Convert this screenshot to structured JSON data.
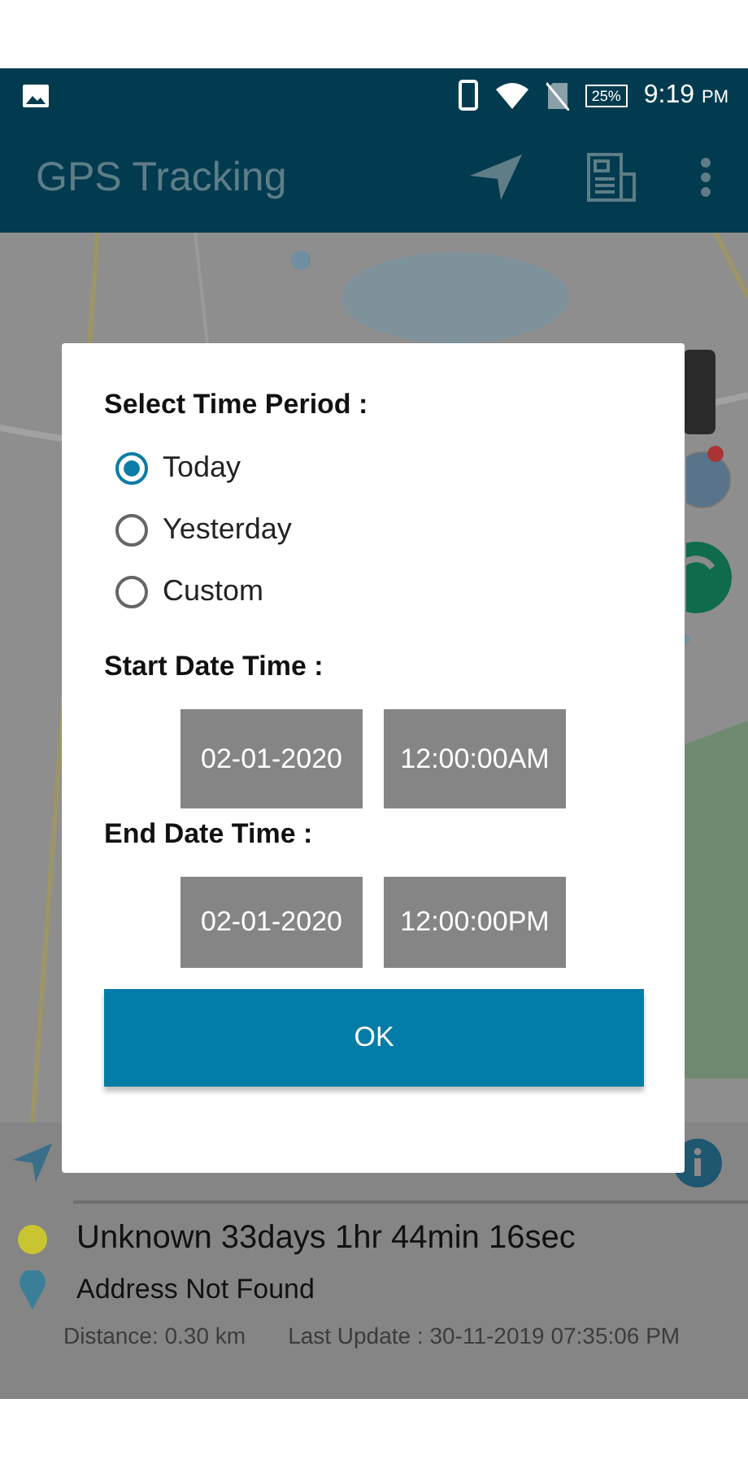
{
  "status_bar": {
    "battery": "25%",
    "time": "9:19",
    "meridiem": "PM"
  },
  "app_bar": {
    "title": "GPS Tracking"
  },
  "dialog": {
    "title": "Select Time Period :",
    "options": [
      {
        "label": "Today",
        "selected": true
      },
      {
        "label": "Yesterday",
        "selected": false
      },
      {
        "label": "Custom",
        "selected": false
      }
    ],
    "start": {
      "label": "Start Date Time :",
      "date": "02-01-2020",
      "time": "12:00:00AM"
    },
    "end": {
      "label": "End Date Time :",
      "date": "02-01-2020",
      "time": "12:00:00PM"
    },
    "ok_button": "OK"
  },
  "info_panel": {
    "status": {
      "text": "Unknown 33days 1hr 44min 16sec",
      "color": "#c9c431"
    },
    "address": "Address Not Found",
    "distance": "Distance: 0.30 km",
    "last_update": "Last Update : 30-11-2019 07:35:06 PM"
  }
}
